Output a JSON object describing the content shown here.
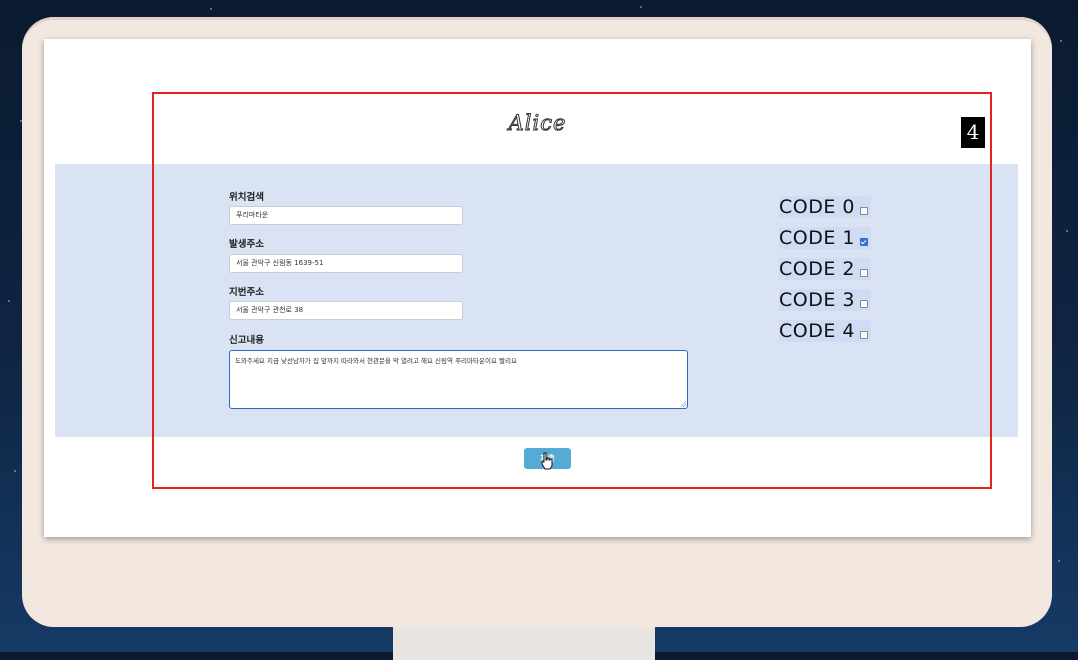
{
  "app": {
    "logo": "Alice"
  },
  "form": {
    "location_search": {
      "label": "위치검색",
      "value": "푸리마타운"
    },
    "incident_address": {
      "label": "발생주소",
      "value": "서울 관악구 신림동 1639-51"
    },
    "lot_address": {
      "label": "지번주소",
      "value": "서울 관악구 관천로 38"
    },
    "report_content": {
      "label": "신고내용",
      "value": "도와주세요  지금  낯선남자가  집  앞까지  따라와서  현관문을  막  열려고  해요  신림역  푸리마타운이요  빨리요"
    }
  },
  "codes": [
    {
      "label": "CODE 0",
      "checked": false
    },
    {
      "label": "CODE 1",
      "checked": true
    },
    {
      "label": "CODE 2",
      "checked": false
    },
    {
      "label": "CODE 3",
      "checked": false
    },
    {
      "label": "CODE 4",
      "checked": false
    }
  ],
  "submit": {
    "label": "제출"
  },
  "annotation": {
    "step": "4"
  },
  "colors": {
    "form_band": "#d9e3f4",
    "submit_button": "#54abd6",
    "highlight": "#e32222"
  }
}
